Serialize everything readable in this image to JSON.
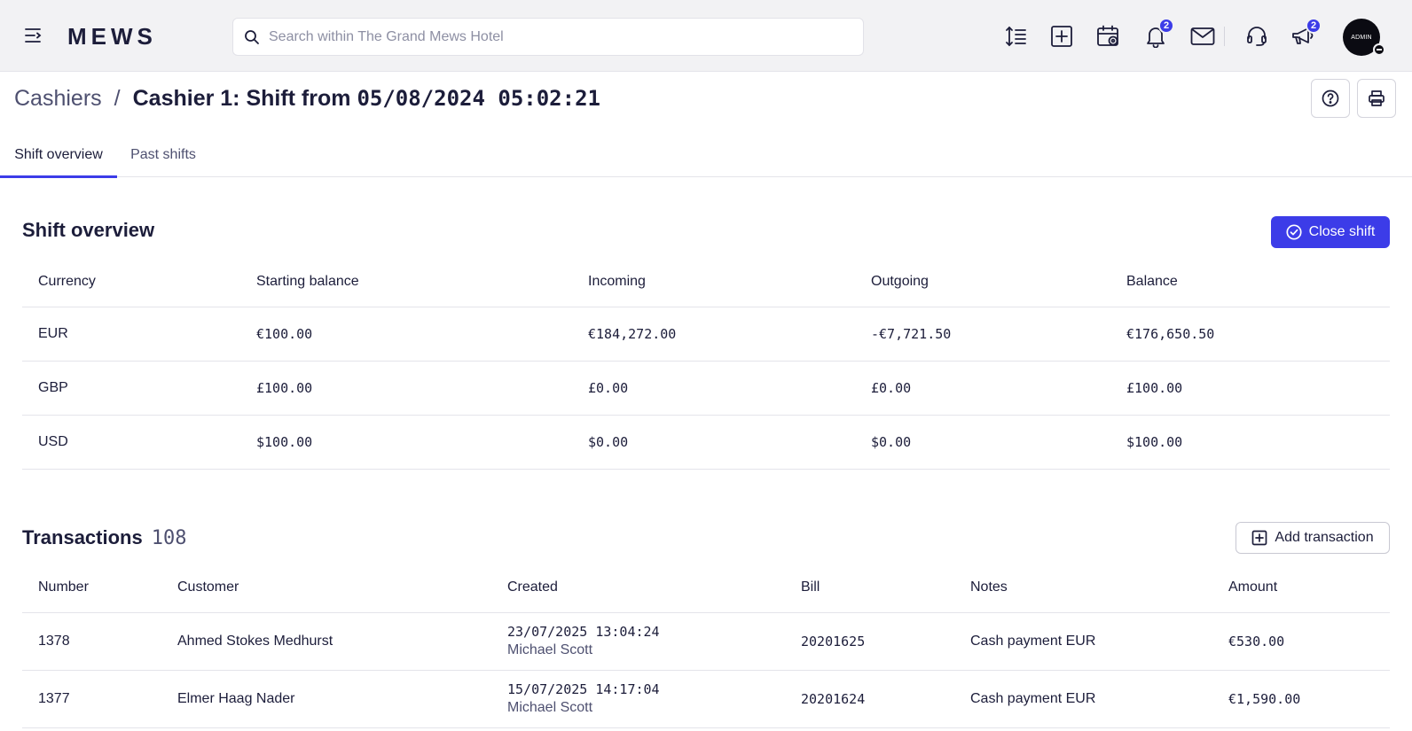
{
  "app": {
    "logo": "MEWS",
    "search_placeholder": "Search within The Grand Mews Hotel",
    "notifications_count": "2",
    "announcements_count": "2",
    "avatar_label": "ADMIN"
  },
  "header": {
    "breadcrumb_root": "Cashiers",
    "separator": "/",
    "title_prefix": "Cashier 1: Shift from ",
    "title_datetime": "05/08/2024 05:02:21"
  },
  "tabs": [
    {
      "label": "Shift overview",
      "active": true
    },
    {
      "label": "Past shifts",
      "active": false
    }
  ],
  "overview": {
    "title": "Shift overview",
    "close_shift_label": "Close shift",
    "columns": [
      "Currency",
      "Starting balance",
      "Incoming",
      "Outgoing",
      "Balance"
    ],
    "rows": [
      {
        "currency": "EUR",
        "starting": "€100.00",
        "incoming": "€184,272.00",
        "outgoing": "-€7,721.50",
        "balance": "€176,650.50"
      },
      {
        "currency": "GBP",
        "starting": "£100.00",
        "incoming": "£0.00",
        "outgoing": "£0.00",
        "balance": "£100.00"
      },
      {
        "currency": "USD",
        "starting": "$100.00",
        "incoming": "$0.00",
        "outgoing": "$0.00",
        "balance": "$100.00"
      }
    ]
  },
  "transactions": {
    "title": "Transactions",
    "count": "108",
    "add_label": "Add transaction",
    "columns": [
      "Number",
      "Customer",
      "Created",
      "Bill",
      "Notes",
      "Amount"
    ],
    "rows": [
      {
        "number": "1378",
        "customer": "Ahmed Stokes Medhurst",
        "created": "23/07/2025 13:04:24",
        "created_by": "Michael Scott",
        "bill": "20201625",
        "notes": "Cash payment EUR",
        "amount": "€530.00"
      },
      {
        "number": "1377",
        "customer": "Elmer Haag Nader",
        "created": "15/07/2025 14:17:04",
        "created_by": "Michael Scott",
        "bill": "20201624",
        "notes": "Cash payment EUR",
        "amount": "€1,590.00"
      }
    ]
  },
  "colors": {
    "accent": "#3c3ce8",
    "topbar_bg": "#f2f2f4",
    "text": "#1c1d3a",
    "muted": "#4e5070"
  },
  "icons": [
    "menu-collapse-icon",
    "search-icon",
    "line-height-icon",
    "add-square-icon",
    "calendar-view-icon",
    "bell-icon",
    "mail-icon",
    "headset-icon",
    "megaphone-icon",
    "help-icon",
    "print-icon",
    "check-circle-icon",
    "plus-square-icon"
  ]
}
